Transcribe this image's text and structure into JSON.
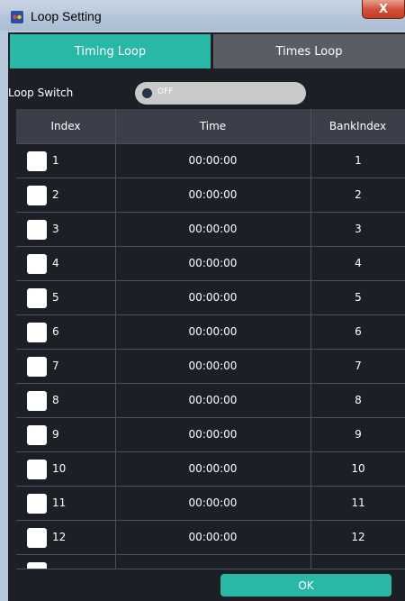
{
  "window": {
    "title": "Loop Setting",
    "close_glyph": "X"
  },
  "tabs": [
    {
      "label": "Timing Loop",
      "active": true
    },
    {
      "label": "Times Loop",
      "active": false
    }
  ],
  "loop_switch": {
    "label": "Loop Switch",
    "state": "OFF"
  },
  "table": {
    "columns": [
      "Index",
      "Time",
      "BankIndex"
    ],
    "rows": [
      {
        "index": "1",
        "time": "00:00:00",
        "bank": "1"
      },
      {
        "index": "2",
        "time": "00:00:00",
        "bank": "2"
      },
      {
        "index": "3",
        "time": "00:00:00",
        "bank": "3"
      },
      {
        "index": "4",
        "time": "00:00:00",
        "bank": "4"
      },
      {
        "index": "5",
        "time": "00:00:00",
        "bank": "5"
      },
      {
        "index": "6",
        "time": "00:00:00",
        "bank": "6"
      },
      {
        "index": "7",
        "time": "00:00:00",
        "bank": "7"
      },
      {
        "index": "8",
        "time": "00:00:00",
        "bank": "8"
      },
      {
        "index": "9",
        "time": "00:00:00",
        "bank": "9"
      },
      {
        "index": "10",
        "time": "00:00:00",
        "bank": "10"
      },
      {
        "index": "11",
        "time": "00:00:00",
        "bank": "11"
      },
      {
        "index": "12",
        "time": "00:00:00",
        "bank": "12"
      }
    ]
  },
  "footer": {
    "ok_label": "OK"
  },
  "colors": {
    "accent": "#2ab8a6",
    "background": "#1c1f26",
    "header": "#3a3f4a"
  }
}
